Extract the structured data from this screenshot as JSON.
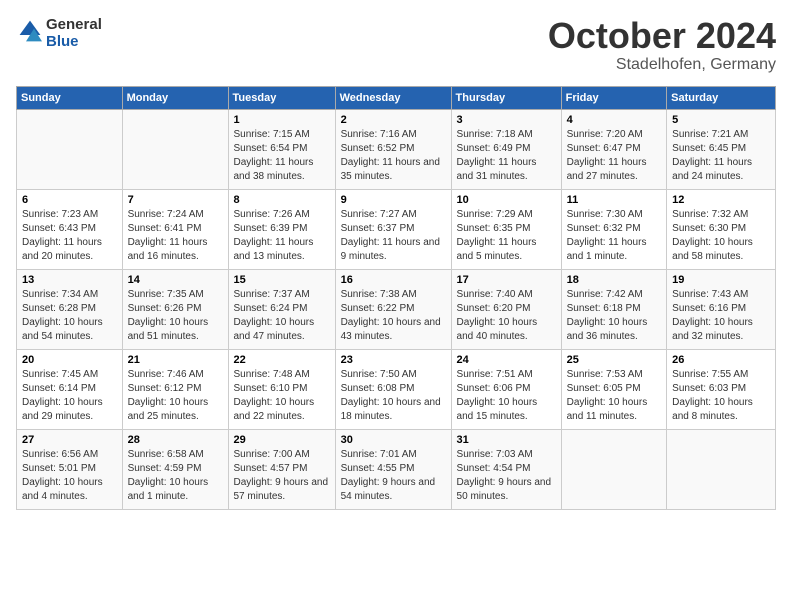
{
  "header": {
    "logo": {
      "general": "General",
      "blue": "Blue"
    },
    "title": "October 2024",
    "location": "Stadelhofen, Germany"
  },
  "calendar": {
    "days_of_week": [
      "Sunday",
      "Monday",
      "Tuesday",
      "Wednesday",
      "Thursday",
      "Friday",
      "Saturday"
    ],
    "weeks": [
      [
        {
          "day": "",
          "info": ""
        },
        {
          "day": "",
          "info": ""
        },
        {
          "day": "1",
          "info": "Sunrise: 7:15 AM\nSunset: 6:54 PM\nDaylight: 11 hours and 38 minutes."
        },
        {
          "day": "2",
          "info": "Sunrise: 7:16 AM\nSunset: 6:52 PM\nDaylight: 11 hours and 35 minutes."
        },
        {
          "day": "3",
          "info": "Sunrise: 7:18 AM\nSunset: 6:49 PM\nDaylight: 11 hours and 31 minutes."
        },
        {
          "day": "4",
          "info": "Sunrise: 7:20 AM\nSunset: 6:47 PM\nDaylight: 11 hours and 27 minutes."
        },
        {
          "day": "5",
          "info": "Sunrise: 7:21 AM\nSunset: 6:45 PM\nDaylight: 11 hours and 24 minutes."
        }
      ],
      [
        {
          "day": "6",
          "info": "Sunrise: 7:23 AM\nSunset: 6:43 PM\nDaylight: 11 hours and 20 minutes."
        },
        {
          "day": "7",
          "info": "Sunrise: 7:24 AM\nSunset: 6:41 PM\nDaylight: 11 hours and 16 minutes."
        },
        {
          "day": "8",
          "info": "Sunrise: 7:26 AM\nSunset: 6:39 PM\nDaylight: 11 hours and 13 minutes."
        },
        {
          "day": "9",
          "info": "Sunrise: 7:27 AM\nSunset: 6:37 PM\nDaylight: 11 hours and 9 minutes."
        },
        {
          "day": "10",
          "info": "Sunrise: 7:29 AM\nSunset: 6:35 PM\nDaylight: 11 hours and 5 minutes."
        },
        {
          "day": "11",
          "info": "Sunrise: 7:30 AM\nSunset: 6:32 PM\nDaylight: 11 hours and 1 minute."
        },
        {
          "day": "12",
          "info": "Sunrise: 7:32 AM\nSunset: 6:30 PM\nDaylight: 10 hours and 58 minutes."
        }
      ],
      [
        {
          "day": "13",
          "info": "Sunrise: 7:34 AM\nSunset: 6:28 PM\nDaylight: 10 hours and 54 minutes."
        },
        {
          "day": "14",
          "info": "Sunrise: 7:35 AM\nSunset: 6:26 PM\nDaylight: 10 hours and 51 minutes."
        },
        {
          "day": "15",
          "info": "Sunrise: 7:37 AM\nSunset: 6:24 PM\nDaylight: 10 hours and 47 minutes."
        },
        {
          "day": "16",
          "info": "Sunrise: 7:38 AM\nSunset: 6:22 PM\nDaylight: 10 hours and 43 minutes."
        },
        {
          "day": "17",
          "info": "Sunrise: 7:40 AM\nSunset: 6:20 PM\nDaylight: 10 hours and 40 minutes."
        },
        {
          "day": "18",
          "info": "Sunrise: 7:42 AM\nSunset: 6:18 PM\nDaylight: 10 hours and 36 minutes."
        },
        {
          "day": "19",
          "info": "Sunrise: 7:43 AM\nSunset: 6:16 PM\nDaylight: 10 hours and 32 minutes."
        }
      ],
      [
        {
          "day": "20",
          "info": "Sunrise: 7:45 AM\nSunset: 6:14 PM\nDaylight: 10 hours and 29 minutes."
        },
        {
          "day": "21",
          "info": "Sunrise: 7:46 AM\nSunset: 6:12 PM\nDaylight: 10 hours and 25 minutes."
        },
        {
          "day": "22",
          "info": "Sunrise: 7:48 AM\nSunset: 6:10 PM\nDaylight: 10 hours and 22 minutes."
        },
        {
          "day": "23",
          "info": "Sunrise: 7:50 AM\nSunset: 6:08 PM\nDaylight: 10 hours and 18 minutes."
        },
        {
          "day": "24",
          "info": "Sunrise: 7:51 AM\nSunset: 6:06 PM\nDaylight: 10 hours and 15 minutes."
        },
        {
          "day": "25",
          "info": "Sunrise: 7:53 AM\nSunset: 6:05 PM\nDaylight: 10 hours and 11 minutes."
        },
        {
          "day": "26",
          "info": "Sunrise: 7:55 AM\nSunset: 6:03 PM\nDaylight: 10 hours and 8 minutes."
        }
      ],
      [
        {
          "day": "27",
          "info": "Sunrise: 6:56 AM\nSunset: 5:01 PM\nDaylight: 10 hours and 4 minutes."
        },
        {
          "day": "28",
          "info": "Sunrise: 6:58 AM\nSunset: 4:59 PM\nDaylight: 10 hours and 1 minute."
        },
        {
          "day": "29",
          "info": "Sunrise: 7:00 AM\nSunset: 4:57 PM\nDaylight: 9 hours and 57 minutes."
        },
        {
          "day": "30",
          "info": "Sunrise: 7:01 AM\nSunset: 4:55 PM\nDaylight: 9 hours and 54 minutes."
        },
        {
          "day": "31",
          "info": "Sunrise: 7:03 AM\nSunset: 4:54 PM\nDaylight: 9 hours and 50 minutes."
        },
        {
          "day": "",
          "info": ""
        },
        {
          "day": "",
          "info": ""
        }
      ]
    ]
  }
}
